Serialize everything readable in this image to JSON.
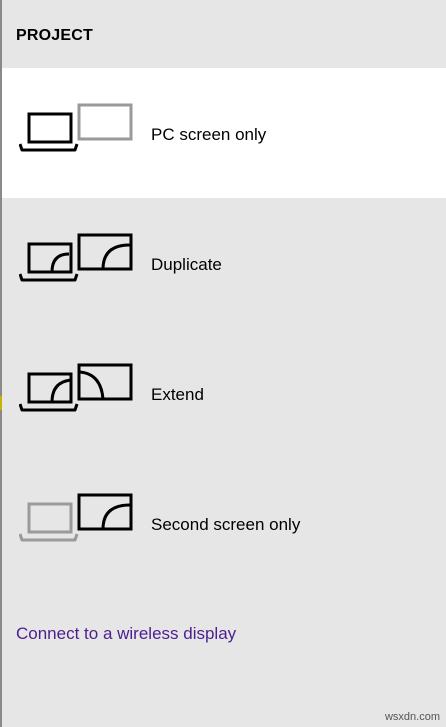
{
  "panel": {
    "title": "PROJECT",
    "options": [
      {
        "label": "PC screen only",
        "icon": "pc-screen-only-icon",
        "selected": true
      },
      {
        "label": "Duplicate",
        "icon": "duplicate-icon",
        "selected": false
      },
      {
        "label": "Extend",
        "icon": "extend-icon",
        "selected": false
      },
      {
        "label": "Second screen only",
        "icon": "second-screen-only-icon",
        "selected": false
      }
    ],
    "wireless_link": "Connect to a wireless display"
  },
  "colors": {
    "background": "#e6e6e6",
    "selected_background": "#ffffff",
    "link": "#4b1f8f",
    "icon_active": "#000000",
    "icon_inactive": "#9a9a9a"
  },
  "watermark": "wsxdn.com"
}
